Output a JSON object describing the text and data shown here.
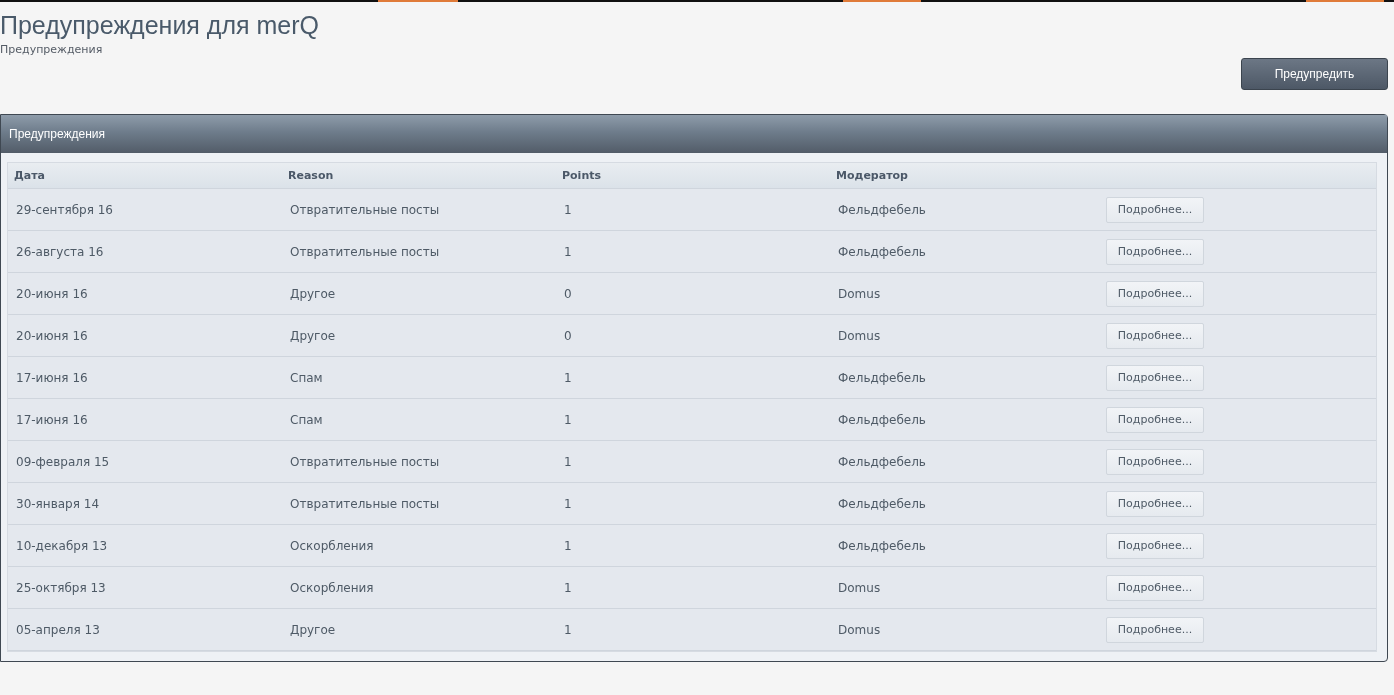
{
  "page": {
    "title": "Предупреждения для merQ",
    "breadcrumb": "Предупреждения",
    "action_button": "Предупредить"
  },
  "panel": {
    "title": "Предупреждения",
    "columns": [
      "Дата",
      "Reason",
      "Points",
      "Модератор"
    ],
    "rows": [
      {
        "date": "29-сентября 16",
        "reason": "Отвратительные посты",
        "points": "1",
        "moderator": "Фельдфебель",
        "button": "Подробнее..."
      },
      {
        "date": "26-августа 16",
        "reason": "Отвратительные посты",
        "points": "1",
        "moderator": "Фельдфебель",
        "button": "Подробнее..."
      },
      {
        "date": "20-июня 16",
        "reason": "Другое",
        "points": "0",
        "moderator": "Domus",
        "button": "Подробнее..."
      },
      {
        "date": "20-июня 16",
        "reason": "Другое",
        "points": "0",
        "moderator": "Domus",
        "button": "Подробнее..."
      },
      {
        "date": "17-июня 16",
        "reason": "Спам",
        "points": "1",
        "moderator": "Фельдфебель",
        "button": "Подробнее..."
      },
      {
        "date": "17-июня 16",
        "reason": "Спам",
        "points": "1",
        "moderator": "Фельдфебель",
        "button": "Подробнее..."
      },
      {
        "date": "09-февраля 15",
        "reason": "Отвратительные посты",
        "points": "1",
        "moderator": "Фельдфебель",
        "button": "Подробнее..."
      },
      {
        "date": "30-января 14",
        "reason": "Отвратительные посты",
        "points": "1",
        "moderator": "Фельдфебель",
        "button": "Подробнее..."
      },
      {
        "date": "10-декабря 13",
        "reason": "Оскорбления",
        "points": "1",
        "moderator": "Фельдфебель",
        "button": "Подробнее..."
      },
      {
        "date": "25-октября 13",
        "reason": "Оскорбления",
        "points": "1",
        "moderator": "Domus",
        "button": "Подробнее..."
      },
      {
        "date": "05-апреля 13",
        "reason": "Другое",
        "points": "1",
        "moderator": "Domus",
        "button": "Подробнее..."
      }
    ]
  }
}
